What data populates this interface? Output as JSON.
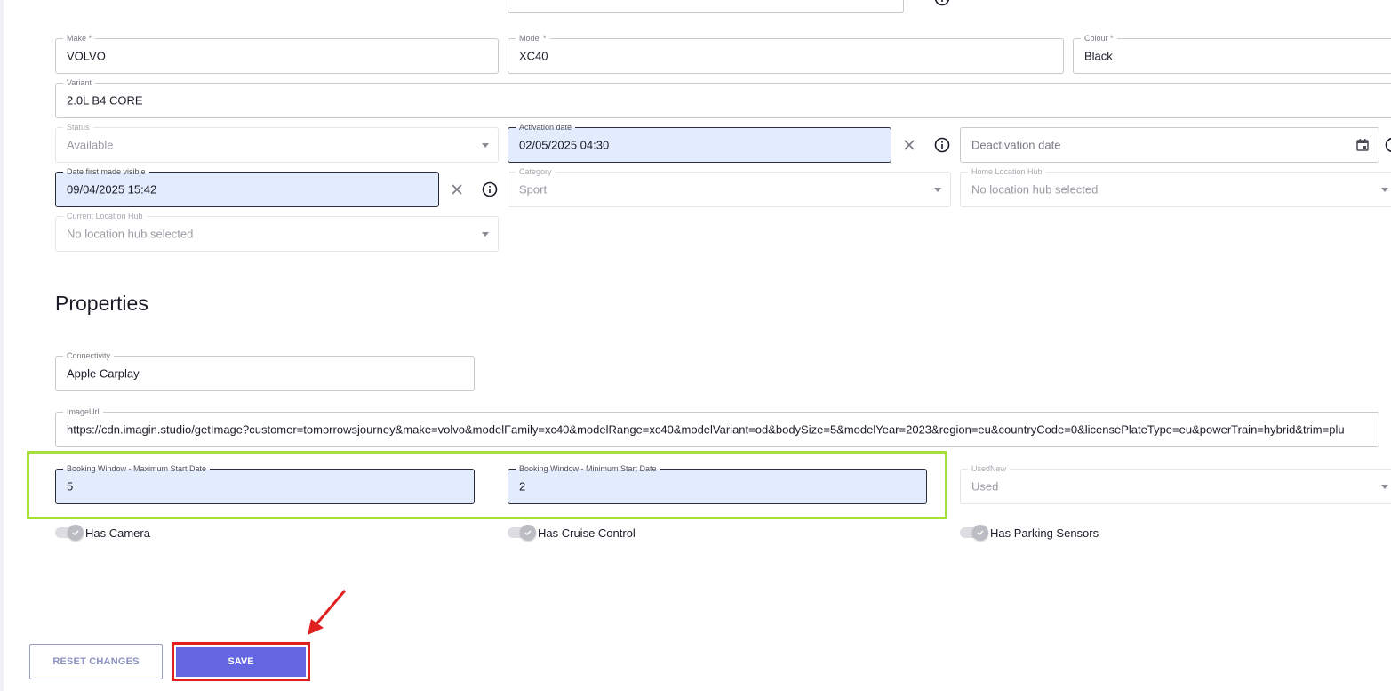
{
  "vehicle": {
    "make": {
      "label": "Make *",
      "value": "VOLVO"
    },
    "model": {
      "label": "Model *",
      "value": "XC40"
    },
    "colour": {
      "label": "Colour *",
      "value": "Black"
    },
    "variant": {
      "label": "Variant",
      "value": "2.0L B4 CORE"
    },
    "status": {
      "label": "Status",
      "value": "Available"
    },
    "activation_date": {
      "label": "Activation date",
      "value": "02/05/2025 04:30"
    },
    "deactivation_date": {
      "placeholder": "Deactivation date"
    },
    "date_first_visible": {
      "label": "Date first made visible",
      "value": "09/04/2025 15:42"
    },
    "category": {
      "label": "Category",
      "value": "Sport"
    },
    "home_location_hub": {
      "label": "Home Location Hub",
      "value": "No location hub selected"
    },
    "current_location_hub": {
      "label": "Current Location Hub",
      "value": "No location hub selected"
    }
  },
  "properties": {
    "title": "Properties",
    "connectivity": {
      "label": "Connectivity",
      "value": "Apple Carplay"
    },
    "image_url": {
      "label": "ImageUrl",
      "value": "https://cdn.imagin.studio/getImage?customer=tomorrowsjourney&make=volvo&modelFamily=xc40&modelRange=xc40&modelVariant=od&bodySize=5&modelYear=2023&region=eu&countryCode=0&licensePlateType=eu&powerTrain=hybrid&trim=plu"
    },
    "booking_max_start": {
      "label": "Booking Window - Maximum Start Date",
      "value": "5"
    },
    "booking_min_start": {
      "label": "Booking Window - Minimum Start Date",
      "value": "2"
    },
    "used_new": {
      "label": "UsedNew",
      "value": "Used"
    },
    "toggles": [
      {
        "label": "Has Camera"
      },
      {
        "label": "Has Cruise Control"
      },
      {
        "label": "Has Parking Sensors"
      }
    ]
  },
  "actions": {
    "reset_label": "RESET CHANGES",
    "save_label": "SAVE"
  },
  "colors": {
    "accent": "#6366e0",
    "highlight_green": "#a7e03a",
    "highlight_red": "#e0201f",
    "filled_field": "#e3ecfc"
  }
}
